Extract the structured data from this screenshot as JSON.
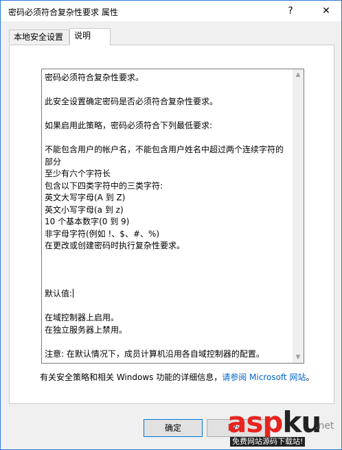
{
  "window": {
    "title": "密码必须符合复杂性要求 属性",
    "help_glyph": "?",
    "close_glyph": "✕"
  },
  "tabs": [
    {
      "label": "本地安全设置"
    },
    {
      "label": "说明"
    }
  ],
  "description_lines": [
    "密码必须符合复杂性要求。",
    "",
    "此安全设置确定密码是否必须符合复杂性要求。",
    "",
    "如果启用此策略，密码必须符合下列最低要求:",
    "",
    "不能包含用户的帐户名，不能包含用户姓名中超过两个连续字符的",
    "部分",
    "至少有六个字符长",
    "包含以下四类字符中的三类字符:",
    "英文大写字母(A 到 Z)",
    "英文小写字母(a 到 z)",
    "10 个基本数字(0 到 9)",
    "非字母字符(例如 !、$、#、%)",
    "在更改或创建密码时执行复杂性要求。",
    "",
    "",
    "",
    "默认值:",
    "",
    "在域控制器上启用。",
    "在独立服务器上禁用。",
    "",
    "注意: 在默认情况下，成员计算机沿用各自域控制器的配置。"
  ],
  "footer": {
    "text": "有关安全策略和相关 Windows 功能的详细信息，",
    "link": "请参阅 Microsoft 网站",
    "end": "。"
  },
  "buttons": {
    "ok": "确定",
    "cancel": "取消"
  },
  "watermark": {
    "main_r": "asp",
    "main_k": "ku",
    "dot": ".net",
    "sub": "免费网站源码下载站!"
  },
  "colors": {
    "accent": "#0078d7",
    "link": "#0066cc",
    "watermark_red": "#e8231f"
  }
}
